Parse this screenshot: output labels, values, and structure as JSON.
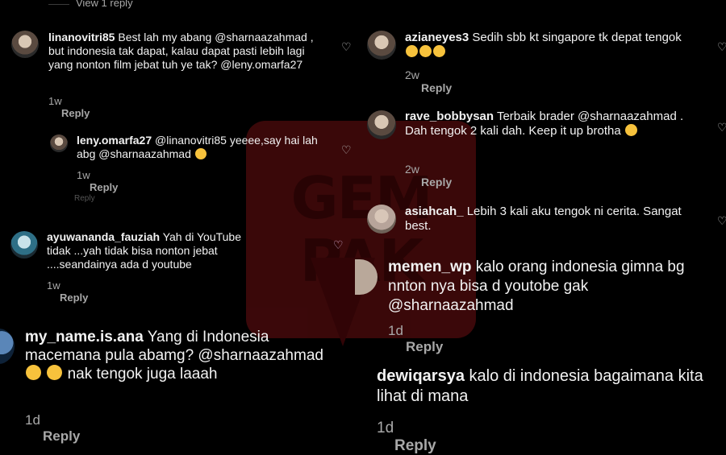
{
  "view_reply": "View 1 reply",
  "left": {
    "comments": [
      {
        "user": "linanovitri85",
        "text": "Best lah my abang @sharnaazahmad , but indonesia tak dapat, kalau dapat pasti lebih lagi yang nonton film jebat tuh ye tak? @leny.omarfa27",
        "time": "1w",
        "reply": "Reply"
      },
      {
        "user": "leny.omarfa27",
        "text": "@linanovitri85 yeeee,say hai lah abg @sharnaazahmad",
        "time": "1w",
        "reply": "Reply"
      },
      {
        "user": "ayuwananda_fauziah",
        "text": "Yah di YouTube tidak ...yah tidak bisa nonton jebat ....seandainya ada d youtube",
        "time": "1w",
        "reply": "Reply"
      },
      {
        "user": "my_name.is.ana",
        "text": "Yang di Indonesia macemana pula abamg? @sharnaazahmad",
        "text_tail": "nak tengok juga laaah",
        "time": "1d",
        "reply": "Reply"
      }
    ],
    "partial_reply": "Reply"
  },
  "right": {
    "comments": [
      {
        "user": "azianeyes3",
        "text": "Sedih sbb kt singapore tk depat tengok",
        "time": "2w",
        "reply": "Reply"
      },
      {
        "user": "rave_bobbysan",
        "text": "Terbaik brader @sharnaazahmad . Dah tengok 2 kali dah. Keep it up brotha",
        "time": "2w",
        "reply": "Reply"
      },
      {
        "user": "asiahcah_",
        "text": "Lebih 3 kali aku tengok ni cerita. Sangat best.",
        "time": "",
        "reply": ""
      },
      {
        "user": "memen_wp",
        "text": "kalo orang indonesia gimna bg nnton nya bisa d youtobe gak @sharnaazahmad",
        "time": "1d",
        "reply": "Reply"
      },
      {
        "user": "dewiqarsya",
        "text": "kalo di indonesia bagaimana kita lihat di mana",
        "time": "1d",
        "reply": "Reply"
      }
    ]
  },
  "watermark": {
    "line1": "GEM",
    "line2": "PAK"
  }
}
